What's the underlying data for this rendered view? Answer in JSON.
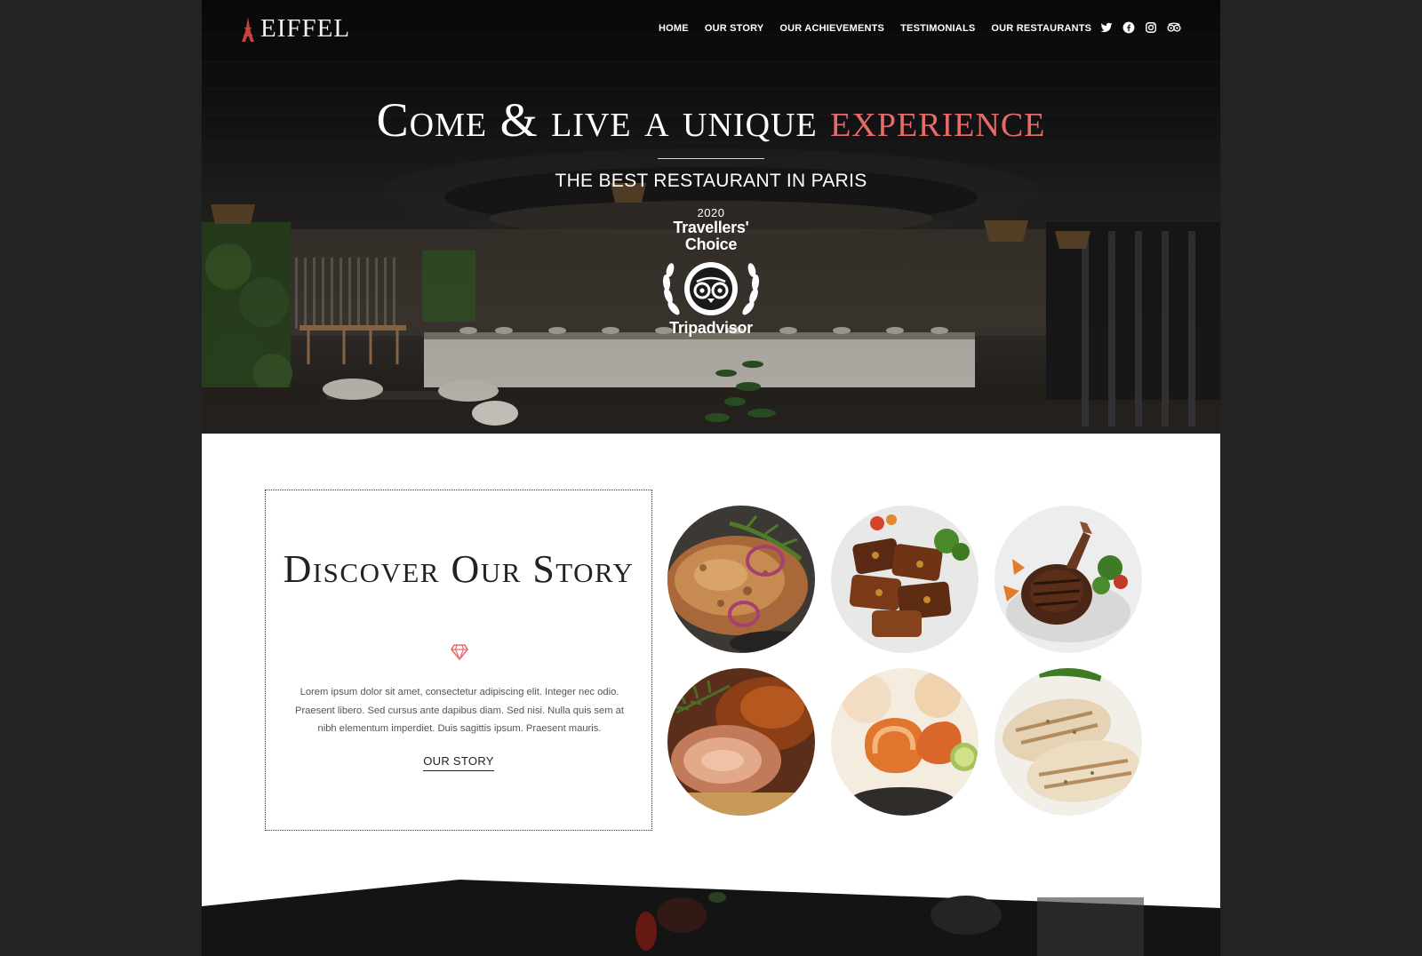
{
  "brand": {
    "name": "EIFFEL"
  },
  "nav": {
    "items": [
      "HOME",
      "OUR STORY",
      "OUR ACHIEVEMENTS",
      "TESTIMONIALS",
      "OUR RESTAURANTS"
    ],
    "social_icons": [
      "twitter-icon",
      "facebook-icon",
      "instagram-icon",
      "tripadvisor-icon"
    ]
  },
  "hero": {
    "title_main": "Come & live a unique ",
    "title_accent": "experience",
    "subtitle": "THE BEST RESTAURANT IN PARIS",
    "badge": {
      "year": "2020",
      "line1": "Travellers'",
      "line2": "Choice",
      "brand": "Tripadvisor"
    }
  },
  "story": {
    "title": "Discover Our Story",
    "text": "Lorem ipsum dolor sit amet, consectetur adipiscing elit. Integer nec odio. Praesent libero. Sed cursus ante dapibus diam. Sed nisi. Nulla quis sem at nibh elementum imperdiet. Duis sagittis ipsum. Praesent mauris.",
    "link_label": "OUR STORY"
  },
  "colors": {
    "accent": "#e86b6b",
    "page_bg": "#222325",
    "content_bg": "#ffffff"
  }
}
